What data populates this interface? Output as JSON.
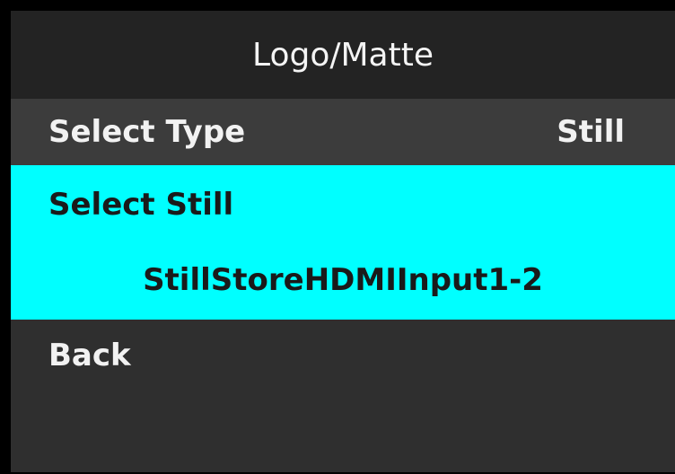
{
  "menu": {
    "title": "Logo/Matte",
    "items": [
      {
        "label": "Select Type",
        "value": "Still"
      },
      {
        "label": "Select Still",
        "value": "StillStoreHDMIInput1-2"
      },
      {
        "label": "Back"
      }
    ]
  },
  "colors": {
    "highlight": "#00ffff",
    "background": "#2f2f2f",
    "title_bar": "#232323",
    "text": "#f2f2f2"
  }
}
